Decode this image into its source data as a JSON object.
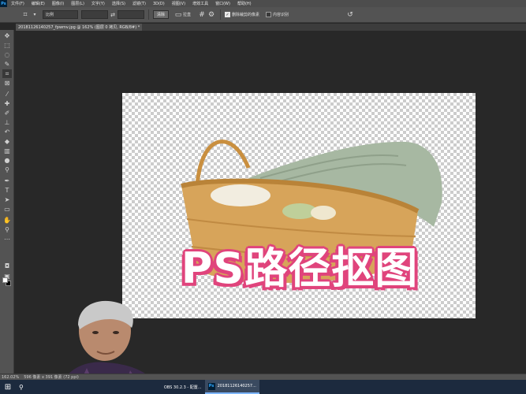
{
  "app": {
    "logo": "Ps"
  },
  "menu": [
    "文件(F)",
    "编辑(E)",
    "图像(I)",
    "图层(L)",
    "文字(Y)",
    "选择(S)",
    "滤镜(T)",
    "3D(D)",
    "视图(V)",
    "增效工具",
    "窗口(W)",
    "帮助(H)"
  ],
  "options": {
    "ratio_value": "比例",
    "clear_label": "清除",
    "straighten_label": "拉直",
    "delete_cropped_label": "删除裁剪的像素",
    "delete_cropped_checked": true,
    "content_aware_label": "内容识别",
    "content_aware_checked": false
  },
  "document": {
    "tab_label": "20181126140257_fpwmv.jpg @ 162% (图层 0 拷贝, RGB/8#) *",
    "title_art": "PS路径抠图"
  },
  "status": {
    "zoom": "162.02%",
    "info": "596 像素 x 391 像素 (72 ppi)"
  },
  "taskbar": {
    "item1": "OBS 30.2.3 - 配置...",
    "item2": "20181126140257..."
  },
  "colors": {
    "accent_pink": "#e0447c",
    "basket": "#d7a45a",
    "towel": "#a7b8a2"
  },
  "tools": [
    "move-icon",
    "marquee-icon",
    "lasso-icon",
    "quick-select-icon",
    "crop-icon",
    "frame-icon",
    "eyedropper-icon",
    "healing-icon",
    "brush-icon",
    "stamp-icon",
    "history-brush-icon",
    "eraser-icon",
    "gradient-icon",
    "blur-icon",
    "dodge-icon",
    "pen-icon",
    "type-icon",
    "path-select-icon",
    "shape-icon",
    "hand-icon",
    "zoom-icon",
    "more-icon"
  ]
}
